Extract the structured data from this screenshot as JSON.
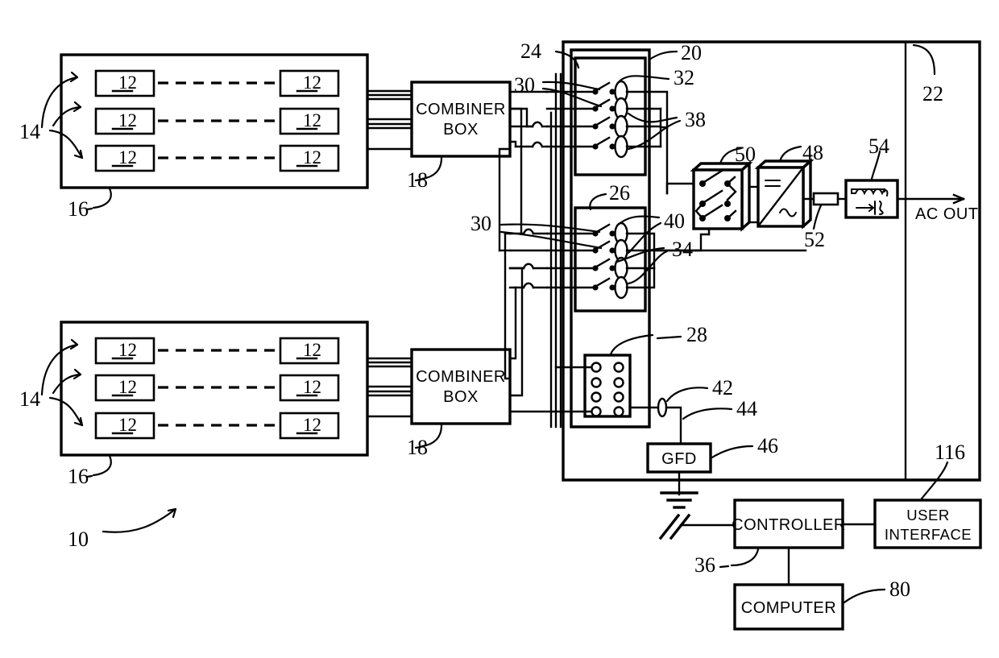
{
  "figure": {
    "kind": "patent-schematic",
    "title": "Photovoltaic power generation system schematic",
    "system_ref": "10"
  },
  "reference_numerals": {
    "system": "10",
    "pv_module": "12",
    "string_pointer": "14",
    "pv_array": "16",
    "combiner_box": "18",
    "switchgear_assembly": "20",
    "enclosure": "22",
    "switch_block_upper": "24",
    "switch_block_lower": "26",
    "terminal_block": "28",
    "switch": "30",
    "fuse_upper": "32",
    "fuse_lower": "34",
    "bus_upper": "38",
    "bus_lower": "40",
    "ground_node": "42",
    "ground_conductor": "44",
    "ground_fault_detector": "46",
    "inverter": "48",
    "contactor": "50",
    "link": "52",
    "filter": "54",
    "controller": "36",
    "computer": "80",
    "user_interface": "116"
  },
  "blocks": {
    "combiner_box_label_line1": "COMBINER",
    "combiner_box_label_line2": "BOX",
    "gfd_label": "GFD",
    "controller_label": "CONTROLLER",
    "computer_label": "COMPUTER",
    "user_interface_line1": "USER",
    "user_interface_line2": "INTERFACE",
    "ac_out_label": "AC  OUT"
  },
  "arrays": [
    {
      "id": "array-top",
      "ref": "16",
      "pointer_ref": "14",
      "combiner_ref": "18",
      "strings": [
        {
          "left_module": "12",
          "right_module": "12"
        },
        {
          "left_module": "12",
          "right_module": "12"
        },
        {
          "left_module": "12",
          "right_module": "12"
        }
      ]
    },
    {
      "id": "array-bottom",
      "ref": "16",
      "pointer_ref": "14",
      "combiner_ref": "18",
      "strings": [
        {
          "left_module": "12",
          "right_module": "12"
        },
        {
          "left_module": "12",
          "right_module": "12"
        },
        {
          "left_module": "12",
          "right_module": "12"
        }
      ]
    }
  ],
  "switch_blocks": [
    {
      "id": "switch-block-upper",
      "ref": "24",
      "switch_ref": "30",
      "fuse_ref": "32",
      "bus_ref": "38",
      "switch_count": 4,
      "fuse_count": 4
    },
    {
      "id": "switch-block-lower",
      "ref": "26",
      "switch_ref": "30",
      "fuse_ref": "34",
      "bus_ref": "40",
      "switch_count": 4,
      "fuse_count": 4
    }
  ],
  "terminal_block": {
    "ref": "28",
    "rows": 4,
    "cols": 2
  },
  "power_chain": [
    {
      "name": "contactor",
      "ref": "50",
      "poles": 3
    },
    {
      "name": "inverter",
      "ref": "48",
      "dc_symbol": "=",
      "ac_symbol": "~"
    },
    {
      "name": "link",
      "ref": "52"
    },
    {
      "name": "filter",
      "ref": "54",
      "elements": [
        "inductor",
        "capacitor"
      ]
    },
    {
      "name": "ac-output",
      "label": "AC  OUT"
    }
  ],
  "ground_chain": {
    "node_ref": "42",
    "conductor_ref": "44",
    "detector_ref": "46",
    "detector_label": "GFD"
  },
  "control_chain": {
    "controller": {
      "ref": "36",
      "label": "CONTROLLER"
    },
    "computer": {
      "ref": "80",
      "label": "COMPUTER"
    },
    "user_interface": {
      "ref": "116",
      "label_line1": "USER",
      "label_line2": "INTERFACE"
    }
  },
  "colors": {
    "ink": "#000000",
    "paper": "#ffffff"
  }
}
